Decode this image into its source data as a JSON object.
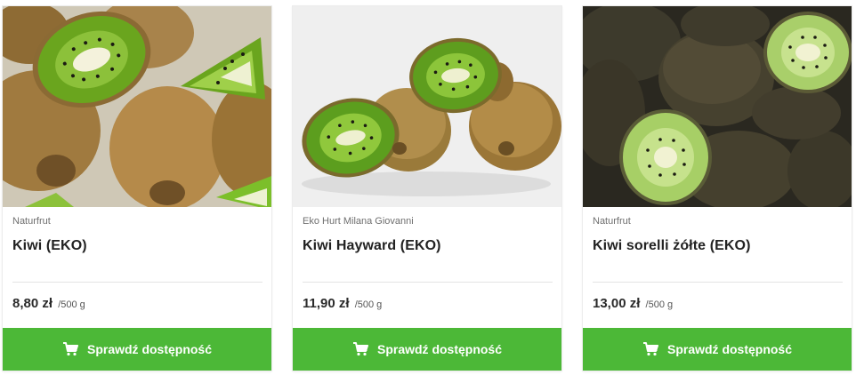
{
  "products": [
    {
      "vendor": "Naturfrut",
      "name": "Kiwi (EKO)",
      "price": "8,80 zł",
      "unit": "/500 g",
      "button_label": "Sprawdź dostępność",
      "image": "kiwi-halves-closeup"
    },
    {
      "vendor": "Eko Hurt Milana Giovanni",
      "name": "Kiwi Hayward (EKO)",
      "price": "11,90 zł",
      "unit": "/500 g",
      "button_label": "Sprawdź dostępność",
      "image": "kiwi-hayward-whole-and-halves"
    },
    {
      "vendor": "Naturfrut",
      "name": "Kiwi sorelli żółte (EKO)",
      "price": "13,00 zł",
      "unit": "/500 g",
      "button_label": "Sprawdź dostępność",
      "image": "kiwi-sorelli-yellow-halves"
    }
  ],
  "colors": {
    "button_green": "#4cb837",
    "kiwi_green": "#6fb52a",
    "kiwi_yellow_green": "#bfe08a"
  },
  "icons": {
    "button": "cart-icon"
  }
}
